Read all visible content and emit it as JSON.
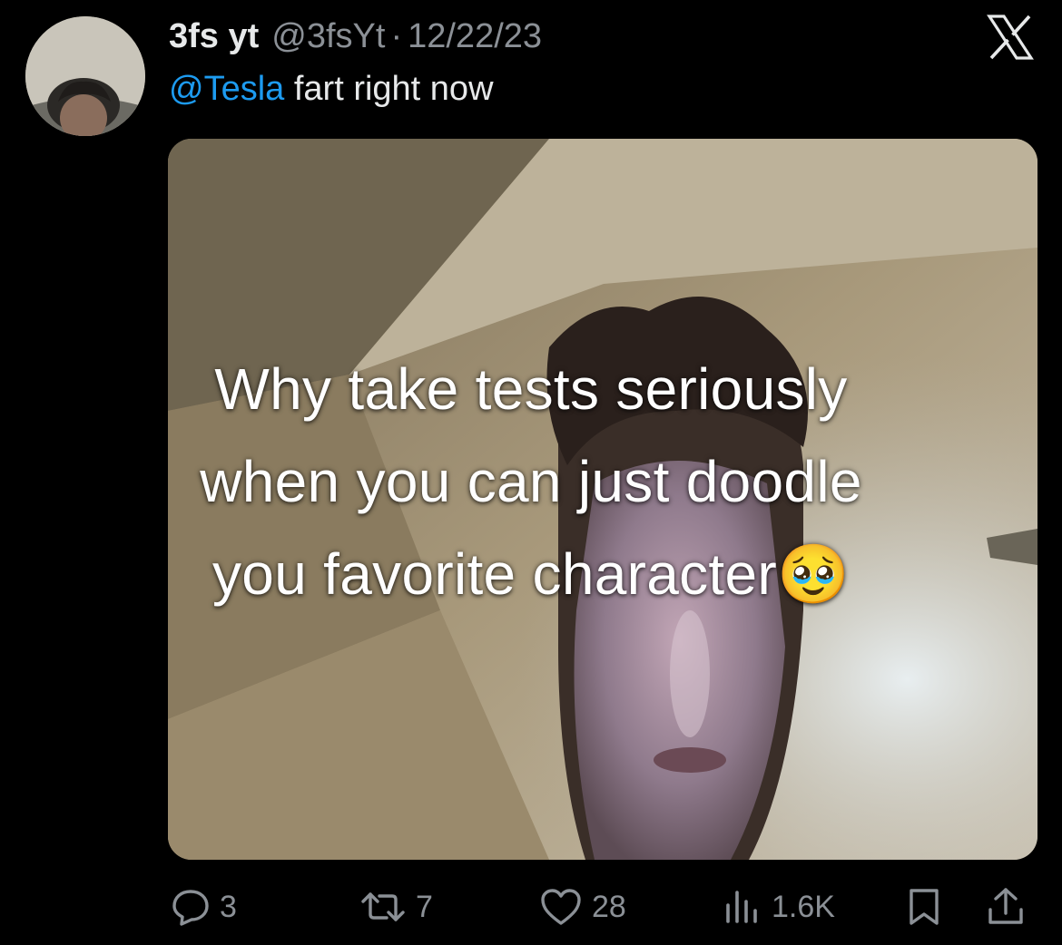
{
  "tweet": {
    "display_name": "3fs yt",
    "handle": "@3fsYt",
    "separator": "·",
    "date": "12/22/23",
    "mention": "@Tesla",
    "text": "fart right now"
  },
  "media": {
    "caption_lines": [
      "Why take tests seriously",
      "when you can just doodle",
      "you favorite character🥹"
    ]
  },
  "actions": {
    "reply_count": "3",
    "retweet_count": "7",
    "like_count": "28",
    "view_count": "1.6K"
  },
  "icons": {
    "close": "x-logo-icon",
    "reply": "reply-bubble-icon",
    "retweet": "retweet-icon",
    "like": "heart-icon",
    "views": "bar-chart-icon",
    "bookmark": "bookmark-icon",
    "share": "share-icon"
  },
  "colors": {
    "background": "#000000",
    "text": "#e7e9ea",
    "secondary": "#8b9096",
    "link": "#1d9bf0"
  }
}
